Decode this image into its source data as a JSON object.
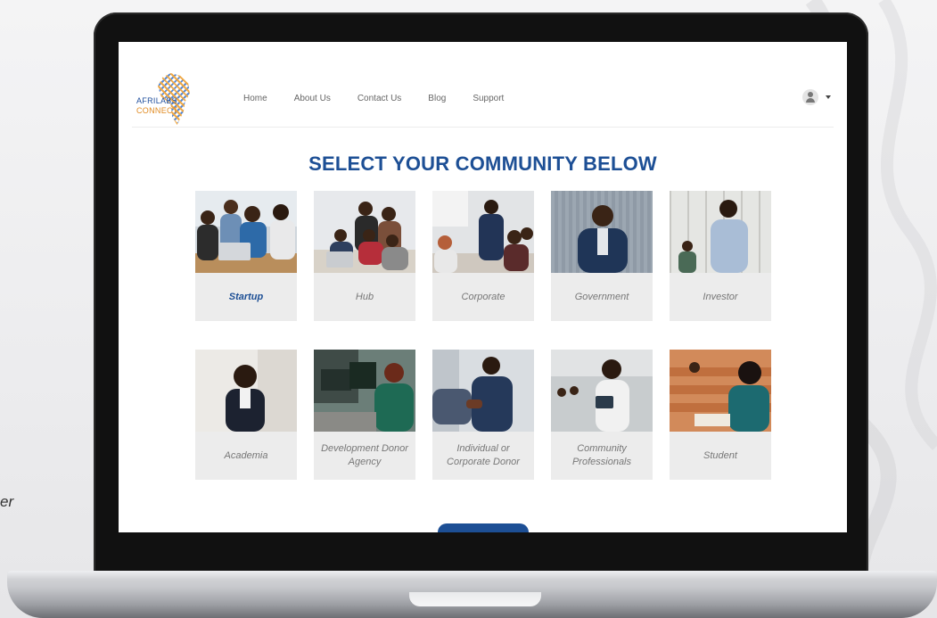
{
  "side_text": "er",
  "header": {
    "logo": {
      "line1": "AFRILABS",
      "line2": "CONNECT"
    },
    "nav": [
      "Home",
      "About Us",
      "Contact Us",
      "Blog",
      "Support"
    ]
  },
  "title": "SELECT YOUR COMMUNITY BELOW",
  "cards": [
    {
      "label": "Startup",
      "active": true
    },
    {
      "label": "Hub"
    },
    {
      "label": "Corporate"
    },
    {
      "label": "Government"
    },
    {
      "label": "Investor"
    },
    {
      "label": "Academia"
    },
    {
      "label": "Development Donor Agency"
    },
    {
      "label": "Individual or Corporate Donor"
    },
    {
      "label": "Community Professionals"
    },
    {
      "label": "Student"
    }
  ],
  "colors": {
    "accent": "#1d4f95",
    "card_bg": "#ececec",
    "logo_orange": "#e08a20"
  }
}
